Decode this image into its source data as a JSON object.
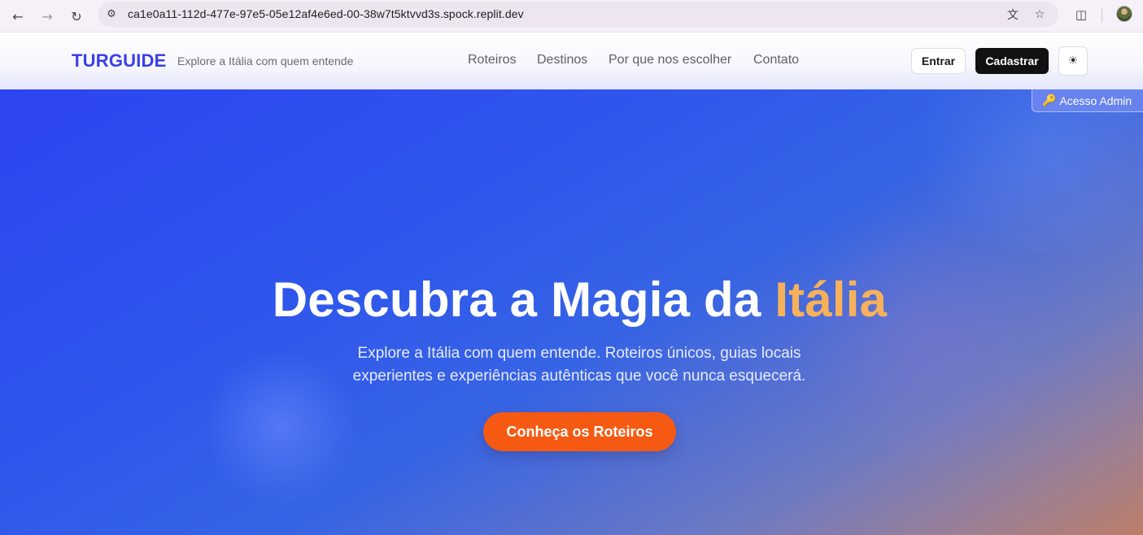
{
  "browser": {
    "url": "ca1e0a11-112d-477e-97e5-05e12af4e6ed-00-38w7t5ktvvd3s.spock.replit.dev",
    "icons": [
      "back-arrow-icon",
      "forward-arrow-icon",
      "reload-icon",
      "site-settings-icon",
      "translate-icon",
      "star-icon",
      "extensions-icon",
      "profile-avatar"
    ]
  },
  "header": {
    "logo": "TURGUIDE",
    "tagline": "Explore a Itália com quem entende",
    "nav": [
      "Roteiros",
      "Destinos",
      "Por que nos escolher",
      "Contato"
    ],
    "login_label": "Entrar",
    "signup_label": "Cadastrar",
    "theme_icon": "sun-icon"
  },
  "admin": {
    "label": "Acesso Admin",
    "icon": "key-icon"
  },
  "hero": {
    "title_main": "Descubra a Magia da ",
    "title_accent": "Itália",
    "subtitle": "Explore a Itália com quem entende. Roteiros únicos, guias locais experientes e experiências autênticas que você nunca esquecerá.",
    "cta_label": "Conheça os Roteiros"
  },
  "colors": {
    "brand": "#3a40e6",
    "accent_text": "#f6b15a",
    "cta": "#f65a12",
    "hero_gradient_start": "#2e44f2",
    "hero_gradient_end": "#bb7d68"
  }
}
